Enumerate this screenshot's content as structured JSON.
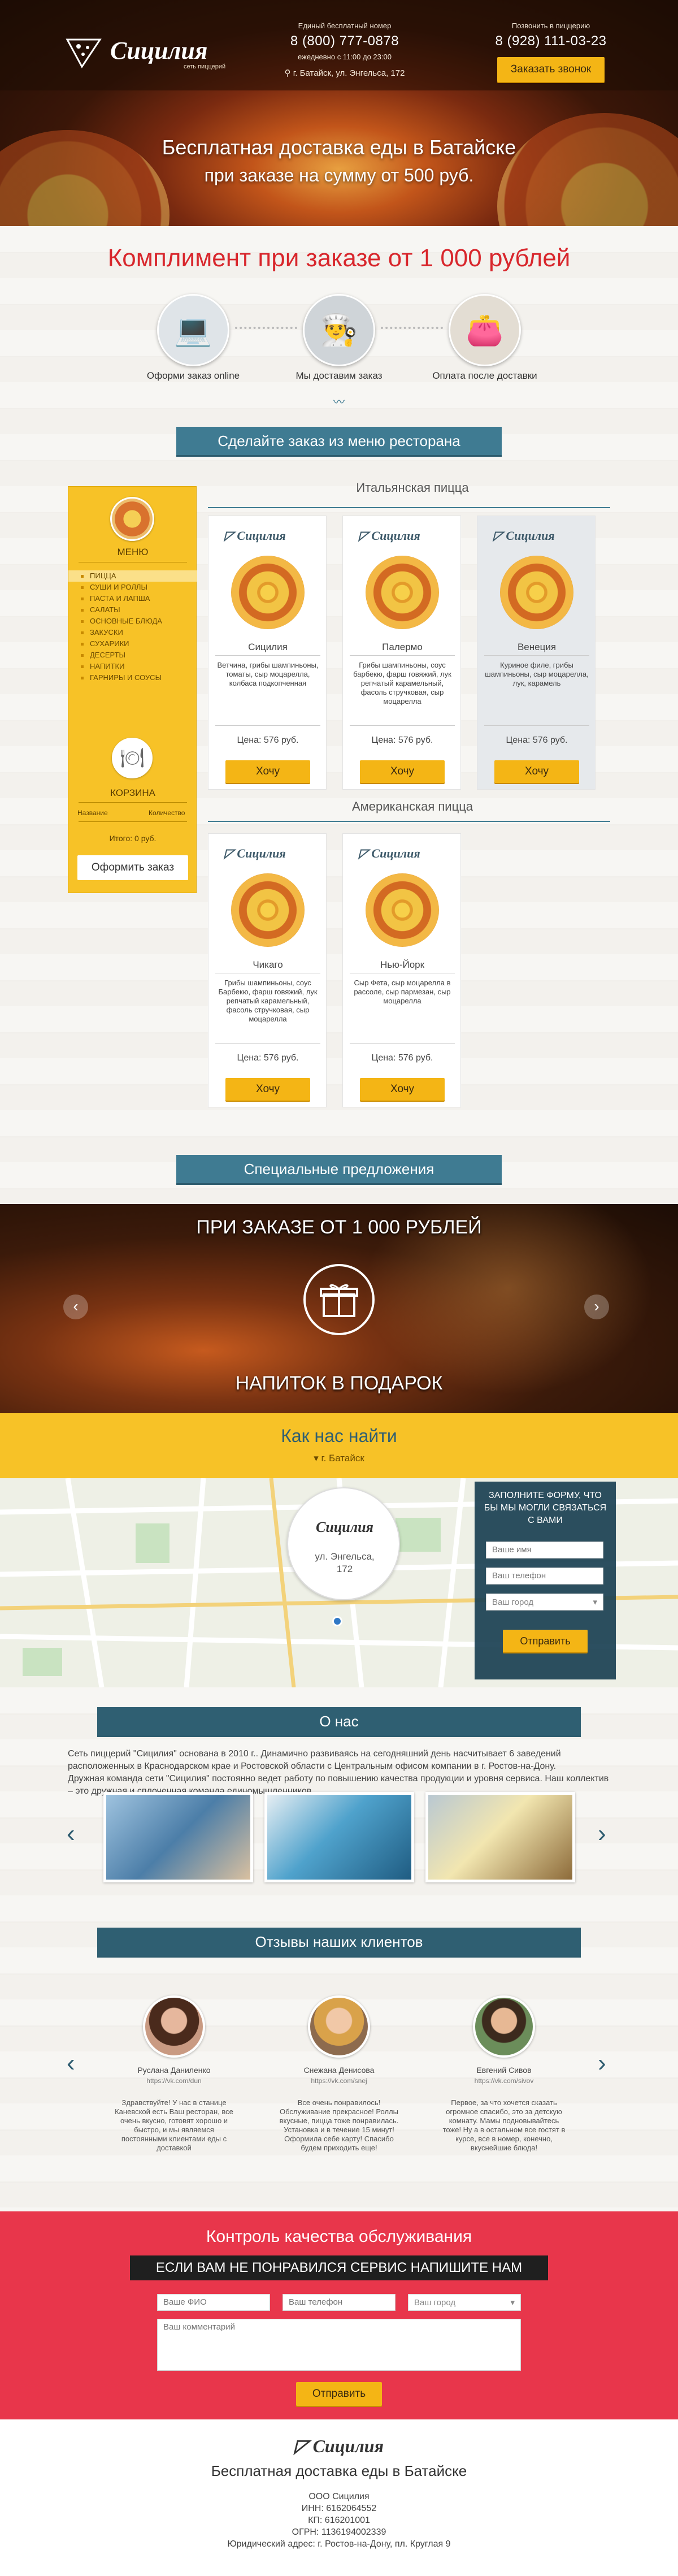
{
  "header": {
    "brand": "Сицилия",
    "brand_sub": "сеть пиццерий",
    "free_label": "Единый бесплатный номер",
    "free_phone": "8 (800) 777-0878",
    "hours": "ежедневно с 11:00 до 23:00",
    "address": "г. Батайск, ул. Энгельса, 172",
    "call_label": "Позвонить в пиццерию",
    "call_phone": "8 (928) 111-03-23",
    "order_call_button": "Заказать звонок",
    "headline": "Бесплатная доставка еды в Батайске",
    "subheadline": "при заказе на сумму от 500 руб."
  },
  "compliment": {
    "title": "Комплимент при заказе от 1 000 рублей",
    "steps": [
      {
        "label": "Оформи заказ online",
        "icon": "laptop-icon"
      },
      {
        "label": "Мы доставим заказ",
        "icon": "chef-icon"
      },
      {
        "label": "Оплата после доставки",
        "icon": "wallet-icon"
      }
    ]
  },
  "order_section": {
    "ribbon": "Сделайте заказ из меню ресторана",
    "cat_italian": "Итальянская пицца",
    "cat_american": "Американская пицца"
  },
  "menu": {
    "title": "МЕНЮ",
    "items": [
      "ПИЦЦА",
      "СУШИ И РОЛЛЫ",
      "ПАСТА И ЛАПША",
      "САЛАТЫ",
      "ОСНОВНЫЕ БЛЮДА",
      "ЗАКУСКИ",
      "СУХАРИКИ",
      "ДЕСЕРТЫ",
      "НАПИТКИ",
      "ГАРНИРЫ И СОУСЫ"
    ],
    "cart_title": "КОРЗИНА",
    "col_name": "Название",
    "col_qty": "Количество",
    "total": "Итого: 0 руб.",
    "checkout_button": "Оформить заказ"
  },
  "pizzas_italian": [
    {
      "name": "Сицилия",
      "desc": "Ветчина, грибы шампиньоны, томаты, сыр моцарелла, колбаса подкопченная",
      "price": "Цена: 576 руб.",
      "button": "Хочу"
    },
    {
      "name": "Палермо",
      "desc": "Грибы шампиньоны, соус барбекю, фарш говяжий, лук репчатый карамельный, фасоль стручковая, сыр моцарелла",
      "price": "Цена: 576 руб.",
      "button": "Хочу"
    },
    {
      "name": "Венеция",
      "desc": "Куриное филе, грибы шампиньоны, сыр моцарелла, лук, карамель",
      "price": "Цена: 576 руб.",
      "button": "Хочу"
    }
  ],
  "pizzas_american": [
    {
      "name": "Чикаго",
      "desc": "Грибы шампиньоны, соус Барбекю, фарш говяжий, лук репчатый карамельный, фасоль стручковая, сыр моцарелла",
      "price": "Цена: 576 руб.",
      "button": "Хочу"
    },
    {
      "name": "Нью-Йорк",
      "desc": "Сыр Фета, сыр моцарелла в рассоле, сыр пармезан, сыр моцарелла",
      "price": "Цена: 576 руб.",
      "button": "Хочу"
    }
  ],
  "specials": {
    "ribbon": "Специальные предложения",
    "top": "ПРИ ЗАКАЗЕ ОТ 1 000 РУБЛЕЙ",
    "bottom": "НАПИТОК В ПОДАРОК"
  },
  "find_us": {
    "title": "Как нас найти",
    "city": "г. Батайск",
    "map_brand": "Сицилия",
    "map_address": "ул. Энгельса, 172",
    "form_title": "ЗАПОЛНИТЕ ФОРМУ, ЧТО БЫ МЫ МОГЛИ СВЯЗАТЬСЯ С ВАМИ",
    "name_ph": "Ваше имя",
    "phone_ph": "Ваш телефон",
    "city_ph": "Ваш город",
    "send_button": "Отправить"
  },
  "about": {
    "ribbon": "О нас",
    "p1": "Сеть пиццерий \"Сицилия\" основана в 2010 г.. Динамично развиваясь на сегодняшний день насчитывает 6 заведений расположенных в Краснодарском крае и Ростовской области с Центральным офисом компании в г. Ростов-на-Дону.",
    "p2": "Дружная команда сети \"Сицилия\" постоянно ведет работу по повышению качества продукции и уровня сервиса. Наш коллектив – это дружная и сплоченная команда единомышленников."
  },
  "reviews": {
    "ribbon": "Отзывы наших клиентов",
    "items": [
      {
        "name": "Руслана Даниленко",
        "link": "https://vk.com/dun",
        "text": "Здравствуйте! У нас в станице Каневской есть Ваш ресторан, все очень вкусно, готовят хорошо и быстро, и мы являемся постоянными клиентами еды с доставкой"
      },
      {
        "name": "Снежана Денисова",
        "link": "https://vk.com/snej",
        "text": "Все очень понравилось! Обслуживание прекрасное! Роллы вкусные, пицца тоже понравилась. Установка и в течение 15 минут! Оформила себе карту! Спасибо будем приходить еще!"
      },
      {
        "name": "Евгений Сивов",
        "link": "https://vk.com/sivov",
        "text": "Первое, за что хочется сказать огромное спасибо, это за детскую комнату. Мамы подновывайтесь тоже! Ну а в остальном все гостят в курсе, все в номер, конечно, вкуснейшие блюда!"
      }
    ]
  },
  "quality": {
    "title": "Контроль качества обслуживания",
    "banner": "ЕСЛИ ВАМ НЕ ПОНРАВИЛСЯ СЕРВИС НАПИШИТЕ НАМ",
    "fio_ph": "Ваше ФИО",
    "phone_ph": "Ваш телефон",
    "city_ph": "Ваш город",
    "comment_ph": "Ваш комментарий",
    "send_button": "Отправить"
  },
  "footer": {
    "brand": "Сицилия",
    "title": "Бесплатная доставка еды в Батайске",
    "lines": [
      "ООО Сицилия",
      "ИНН: 6162064552",
      "КП: 616201001",
      "ОГРН: 1136194002339",
      "Юридический адрес: г. Ростов-на-Дону, пл. Круглая 9"
    ]
  },
  "colors": {
    "accent_yellow": "#f4b515",
    "teal": "#3f7b92",
    "red": "#e8364b"
  }
}
